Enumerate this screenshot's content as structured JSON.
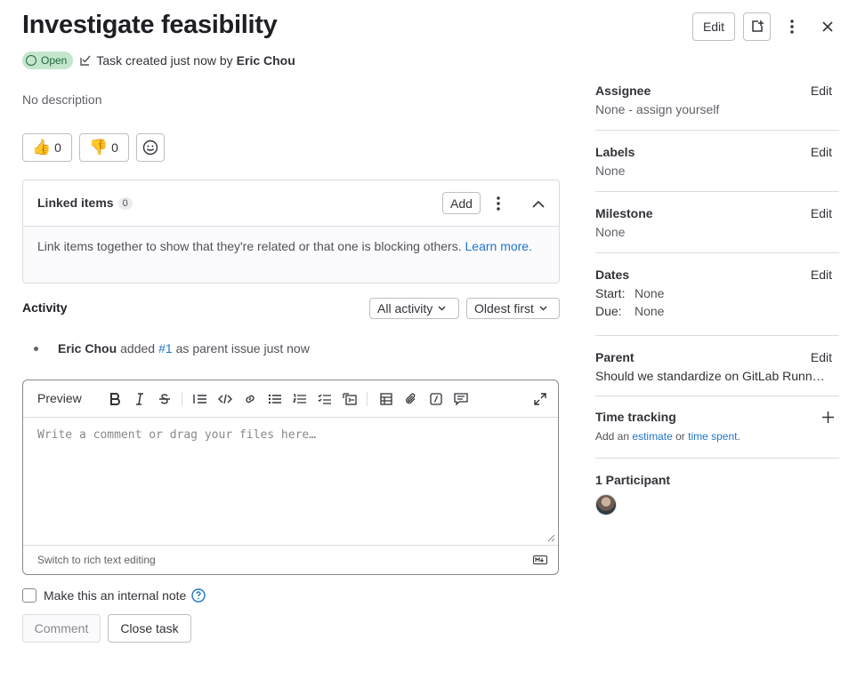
{
  "header": {
    "title": "Investigate feasibility",
    "edit_label": "Edit",
    "status": "Open",
    "created_text": "Task created just now by",
    "author": "Eric Chou"
  },
  "description": {
    "empty_text": "No description"
  },
  "reactions": [
    {
      "emoji": "👍",
      "count": "0"
    },
    {
      "emoji": "👎",
      "count": "0"
    }
  ],
  "linked_items": {
    "title": "Linked items",
    "count": "0",
    "add_label": "Add",
    "help_text": "Link items together to show that they're related or that one is blocking others.",
    "learn_more": "Learn more."
  },
  "activity": {
    "title": "Activity",
    "filter": "All activity",
    "sort": "Oldest first",
    "items": [
      {
        "author": "Eric Chou",
        "verb": "added",
        "ref": "#1",
        "rest": "as parent issue just now"
      }
    ]
  },
  "editor": {
    "preview_tab": "Preview",
    "placeholder": "Write a comment or drag your files here…",
    "switch_label": "Switch to rich text editing",
    "toolbar_icons": [
      "bold-icon",
      "italic-icon",
      "strikethrough-icon",
      "quote-icon",
      "code-icon",
      "link-icon",
      "bullet-list-icon",
      "numbered-list-icon",
      "task-list-icon",
      "collapsible-icon",
      "table-icon",
      "attach-icon",
      "quick-action-icon",
      "comment-template-icon",
      "fullscreen-icon"
    ]
  },
  "internal_note": {
    "label": "Make this an internal note"
  },
  "buttons": {
    "comment": "Comment",
    "close": "Close task"
  },
  "sidebar": {
    "edit_label": "Edit",
    "assignee": {
      "title": "Assignee",
      "value": "None - assign yourself"
    },
    "labels": {
      "title": "Labels",
      "value": "None"
    },
    "milestone": {
      "title": "Milestone",
      "value": "None"
    },
    "dates": {
      "title": "Dates",
      "start_label": "Start:",
      "start_value": "None",
      "due_label": "Due:",
      "due_value": "None"
    },
    "parent": {
      "title": "Parent",
      "value": "Should we standardize on GitLab Runn…"
    },
    "time_tracking": {
      "title": "Time tracking",
      "prefix": "Add an",
      "estimate": "estimate",
      "or": "or",
      "time_spent": "time spent",
      "suffix": "."
    },
    "participants": {
      "title": "1 Participant"
    }
  },
  "colors": {
    "status_bg": "#c3e6cd",
    "status_fg": "#24663b",
    "link": "#1f75cb"
  }
}
